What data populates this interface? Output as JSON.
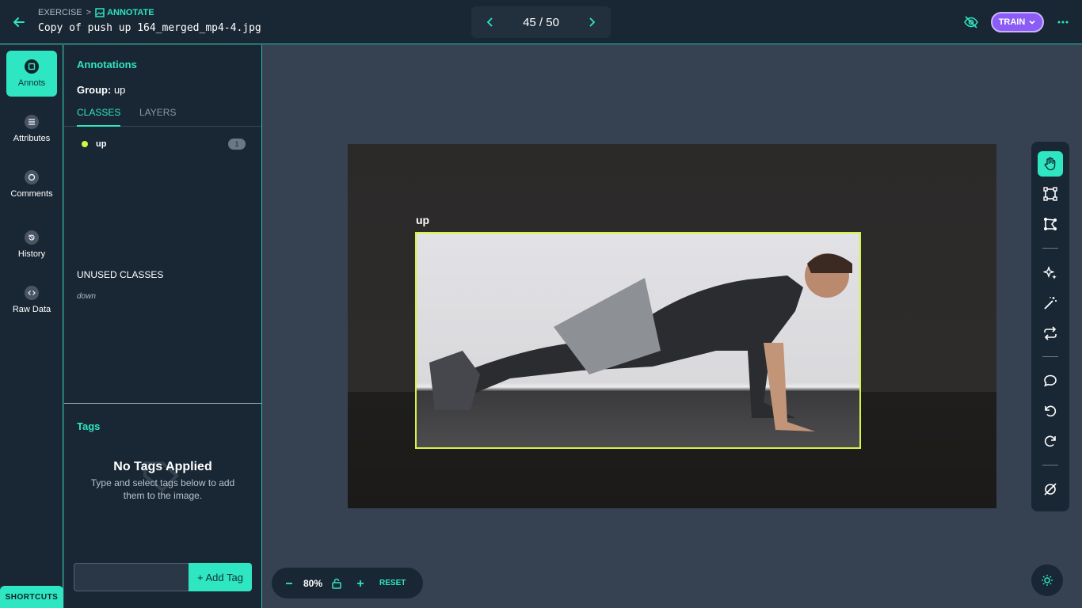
{
  "header": {
    "breadcrumb_project": "EXERCISE",
    "breadcrumb_separator": ">",
    "breadcrumb_mode": "ANNOTATE",
    "filename": "Copy of push up 164_merged_mp4-4.jpg",
    "pager": "45 / 50",
    "train_label": "TRAIN"
  },
  "sidebar": {
    "items": [
      {
        "label": "Annots",
        "icon": "square-annotation-icon"
      },
      {
        "label": "Attributes",
        "icon": "list-icon"
      },
      {
        "label": "Comments",
        "icon": "comment-icon"
      },
      {
        "label": "History",
        "icon": "history-icon"
      },
      {
        "label": "Raw Data",
        "icon": "code-icon"
      }
    ],
    "shortcuts_label": "SHORTCUTS"
  },
  "panel": {
    "title": "Annotations",
    "group_label": "Group:",
    "group_value": "up",
    "tabs": {
      "classes": "CLASSES",
      "layers": "LAYERS"
    },
    "classes": [
      {
        "name": "up",
        "count": "1",
        "color": "#d4f542"
      }
    ],
    "unused_title": "UNUSED CLASSES",
    "unused_classes": [
      "down"
    ],
    "tags_title": "Tags",
    "tags_empty_title": "No Tags Applied",
    "tags_empty_text": "Type and select tags below to add them to the image.",
    "add_tag_label": "+ Add Tag",
    "tag_input_value": ""
  },
  "canvas": {
    "annotation_label": "up",
    "annotation_color": "#d4f542"
  },
  "zoom": {
    "value": "80%",
    "reset_label": "RESET"
  },
  "colors": {
    "accent": "#2ee6c1",
    "train": "#8b5cf6",
    "background": "#364152",
    "panel": "#192734"
  }
}
